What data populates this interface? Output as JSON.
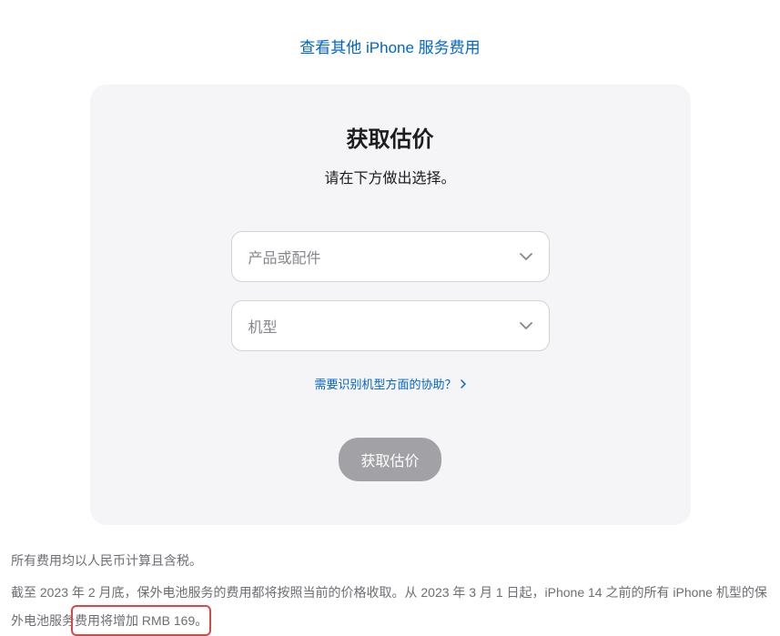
{
  "topLink": "查看其他 iPhone 服务费用",
  "card": {
    "title": "获取估价",
    "subtitle": "请在下方做出选择。",
    "select1Placeholder": "产品或配件",
    "select2Placeholder": "机型",
    "helpLink": "需要识别机型方面的协助？",
    "submitLabel": "获取估价"
  },
  "footer": {
    "line1": "所有费用均以人民币计算且含税。",
    "line2a": "截至 2023 年 2 月底，保外电池服务的费用都将按照当前的价格收取。从 2023 年 3 月 1 日起，iPhone 14 之前的所有 iPhone 机型的保外电池服务",
    "line2b": "费用将增加 RMB 169。"
  }
}
